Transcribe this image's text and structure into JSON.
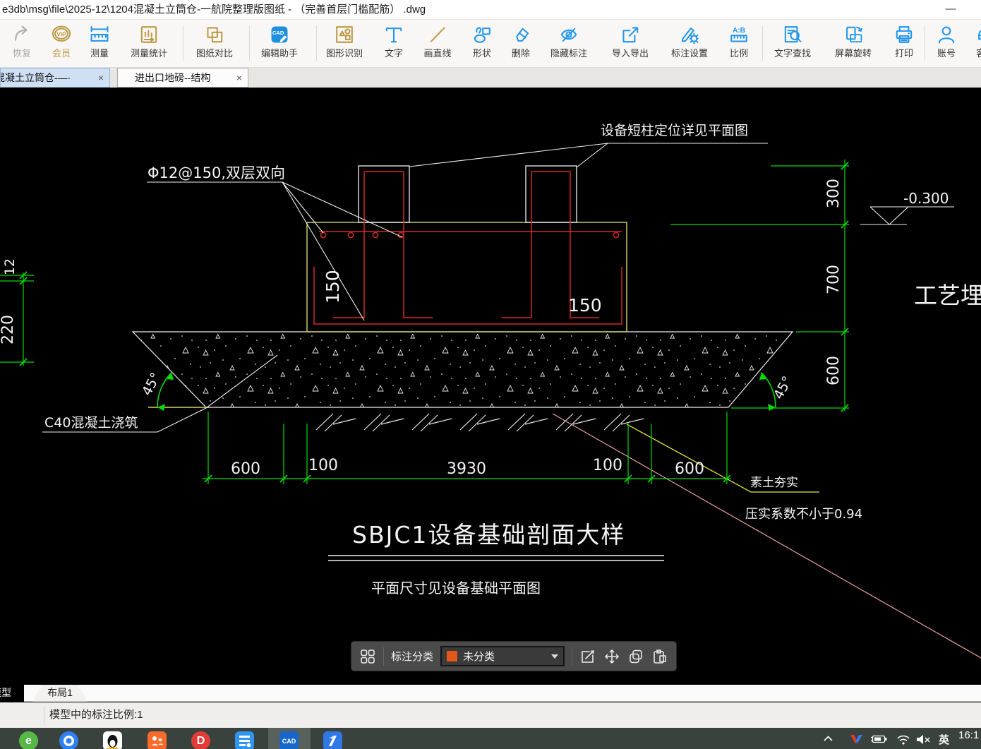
{
  "window": {
    "title": "e3db\\msg\\file\\2025-12\\1204混凝土立筒仓-一航院整理版图纸 -  （完善首层门槛配筋） .dwg",
    "minimize": "—"
  },
  "toolbar": {
    "vip_badge": "VIP",
    "ratio_badge": "A:B",
    "cad_badge": "CAD",
    "buttons": [
      {
        "label": "恢复"
      },
      {
        "label": "会员"
      },
      {
        "label": "测量"
      },
      {
        "label": "测量统计"
      },
      {
        "label": "图纸对比"
      },
      {
        "label": "编辑助手"
      },
      {
        "label": "图形识别"
      },
      {
        "label": "文字"
      },
      {
        "label": "画直线"
      },
      {
        "label": "形状"
      },
      {
        "label": "删除"
      },
      {
        "label": "隐藏标注"
      },
      {
        "label": "导入导出"
      },
      {
        "label": "标注设置"
      },
      {
        "label": "比例"
      },
      {
        "label": "文字查找"
      },
      {
        "label": "屏幕旋转"
      },
      {
        "label": "打印"
      },
      {
        "label": "账号"
      },
      {
        "label": "客服"
      }
    ]
  },
  "tabs": [
    {
      "label": "混凝土立筒仓-—·",
      "close": "×",
      "active": true
    },
    {
      "label": "进出口地磅--结构",
      "close": "×",
      "active": false
    }
  ],
  "drawing": {
    "annotations": {
      "column_leader": "设备短柱定位详见平面图",
      "rebar_note": "Φ12@150,双层双向",
      "level": "-0.300",
      "embed_parts": "工艺埋件",
      "concrete_note": "C40混凝土浇筑",
      "soil_note": "素土夯实",
      "compaction_note": "压实系数不小于0.94",
      "title": "SBJC1设备基础剖面大样",
      "subtitle": "平面尺寸见设备基础平面图"
    },
    "dimensions": {
      "bottom": [
        "600",
        "100",
        "3930",
        "100",
        "600"
      ],
      "right": [
        "300",
        "700",
        "600"
      ],
      "left": [
        "12",
        "220"
      ],
      "inner": [
        "150",
        "150"
      ],
      "angle_left": "45°",
      "angle_right": "45°"
    }
  },
  "floating_toolbar": {
    "category_label": "标注分类",
    "selected_category": "未分类",
    "swatch_color": "#e2571a"
  },
  "sheet_tabs": {
    "model": "模型",
    "layout": "布局1"
  },
  "status_bar": {
    "text": "模型中的标注比例:1"
  },
  "taskbar": {
    "app_letters": {
      "browser_e": "e",
      "d_app": "D",
      "cad": "CAD"
    },
    "tray": {
      "ime": "英",
      "time": "16:1"
    }
  },
  "colors": {
    "canvas_bg": "#000000",
    "dimension_green": "#00dd00",
    "foundation_yellow": "#d6d66e",
    "rebar_red": "#d42a22",
    "leader_pink": "#eda0a0",
    "leader_yellow": "#e6e63c",
    "accent_blue": "#2196ee",
    "accent_gold": "#bd9a45",
    "active_tab_bg": "#cfe0f4",
    "taskbar_bg": "#3a423e"
  }
}
